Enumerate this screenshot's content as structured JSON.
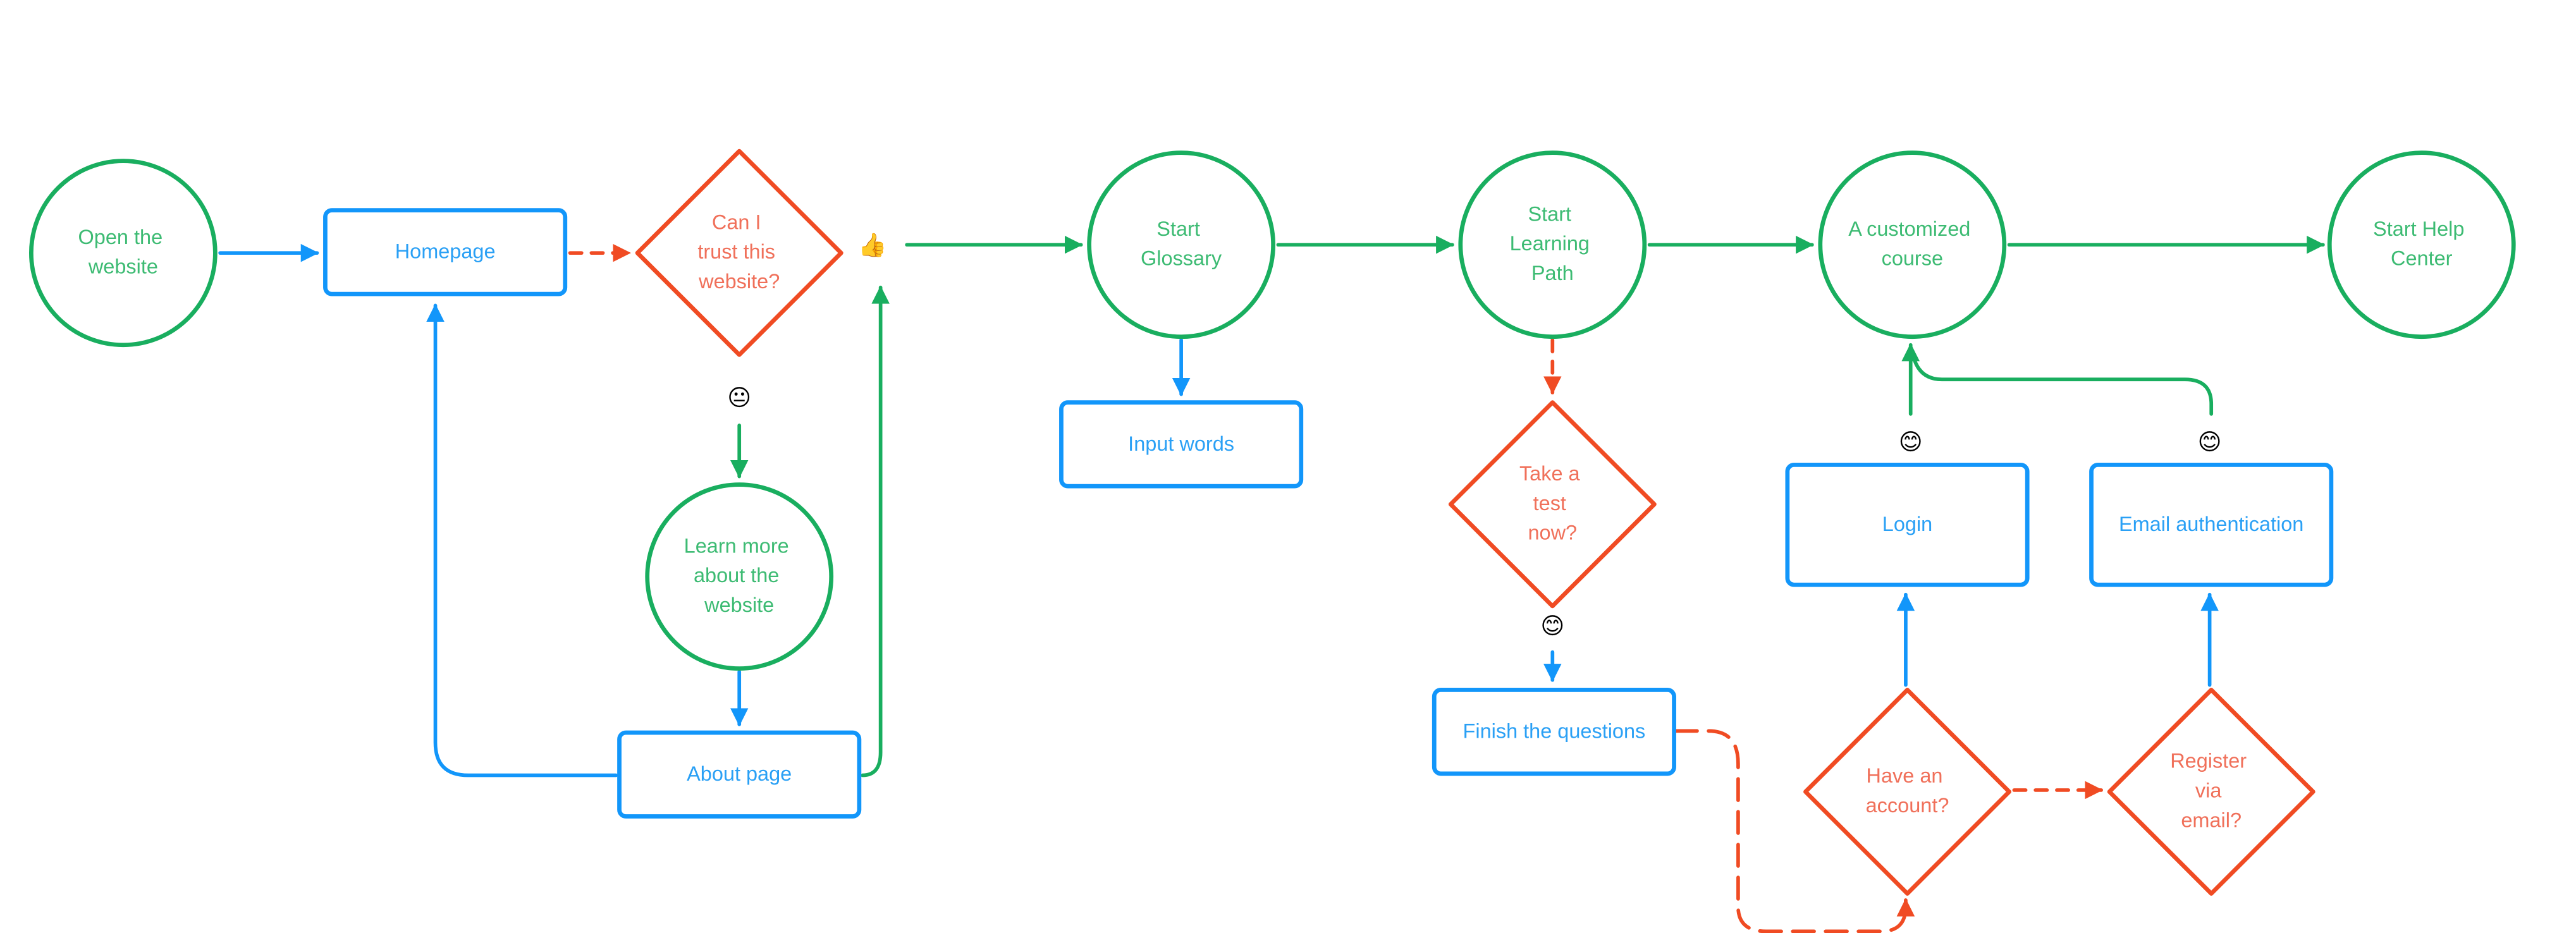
{
  "colors": {
    "process": "#1296FA",
    "process_text": "#2AA0F5",
    "terminal": "#19AE5F",
    "terminal_text": "#3DBB73",
    "decision": "#F04B23",
    "decision_text": "#F0705A"
  },
  "nodes": {
    "open_website": {
      "type": "circle",
      "lines": [
        "Open the",
        "website"
      ]
    },
    "homepage": {
      "type": "rect",
      "lines": [
        "Homepage"
      ]
    },
    "trust_decision": {
      "type": "diamond",
      "lines": [
        "Can I",
        "trust this",
        "website?"
      ]
    },
    "learn_more": {
      "type": "circle",
      "lines": [
        "Learn more",
        "about the",
        "website"
      ]
    },
    "about_page": {
      "type": "rect",
      "lines": [
        "About page"
      ]
    },
    "start_glossary": {
      "type": "circle",
      "lines": [
        "Start",
        "Glossary"
      ]
    },
    "input_words": {
      "type": "rect",
      "lines": [
        "Input words"
      ]
    },
    "start_learning_path": {
      "type": "circle",
      "lines": [
        "Start",
        "Learning",
        "Path"
      ]
    },
    "take_test": {
      "type": "diamond",
      "lines": [
        "Take a",
        "test",
        "now?"
      ]
    },
    "finish_questions": {
      "type": "rect",
      "lines": [
        "Finish the questions"
      ]
    },
    "customized_course": {
      "type": "circle",
      "lines": [
        "A customized",
        "course"
      ]
    },
    "start_help_center": {
      "type": "circle",
      "lines": [
        "Start Help",
        "Center"
      ]
    },
    "login": {
      "type": "rect",
      "lines": [
        "Login"
      ]
    },
    "email_auth": {
      "type": "rect",
      "lines": [
        "Email authentication"
      ]
    },
    "have_account": {
      "type": "diamond",
      "lines": [
        "Have an",
        "account?"
      ]
    },
    "register_email": {
      "type": "diamond",
      "lines": [
        "Register",
        "via",
        "email?"
      ]
    }
  },
  "emojis": {
    "thumbs_up": "👍",
    "neutral_face": "😐",
    "smile_test": "😊",
    "smile_login": "😊",
    "smile_email": "😊"
  },
  "edges": [
    {
      "from": "open_website",
      "to": "homepage",
      "style": "solid",
      "color": "process"
    },
    {
      "from": "homepage",
      "to": "trust_decision",
      "style": "dashed",
      "color": "decision"
    },
    {
      "from": "trust_decision",
      "to": "start_glossary",
      "style": "solid",
      "color": "terminal",
      "label": "thumbs_up"
    },
    {
      "from": "trust_decision",
      "to": "learn_more",
      "style": "solid",
      "color": "terminal",
      "label": "neutral_face"
    },
    {
      "from": "learn_more",
      "to": "about_page",
      "style": "solid",
      "color": "process"
    },
    {
      "from": "about_page",
      "to": "homepage",
      "style": "solid",
      "color": "process"
    },
    {
      "from": "about_page",
      "to": "trust_decision",
      "style": "solid",
      "color": "terminal"
    },
    {
      "from": "start_glossary",
      "to": "input_words",
      "style": "solid",
      "color": "process"
    },
    {
      "from": "start_glossary",
      "to": "start_learning_path",
      "style": "solid",
      "color": "terminal"
    },
    {
      "from": "start_learning_path",
      "to": "take_test",
      "style": "dashed",
      "color": "decision"
    },
    {
      "from": "take_test",
      "to": "finish_questions",
      "style": "dashed",
      "color": "process",
      "label": "smile_test"
    },
    {
      "from": "finish_questions",
      "to": "have_account",
      "style": "dashed",
      "color": "decision"
    },
    {
      "from": "start_learning_path",
      "to": "customized_course",
      "style": "solid",
      "color": "terminal"
    },
    {
      "from": "customized_course",
      "to": "start_help_center",
      "style": "solid",
      "color": "terminal"
    },
    {
      "from": "have_account",
      "to": "login",
      "style": "solid",
      "color": "process"
    },
    {
      "from": "have_account",
      "to": "register_email",
      "style": "dashed",
      "color": "decision"
    },
    {
      "from": "register_email",
      "to": "email_auth",
      "style": "solid",
      "color": "process"
    },
    {
      "from": "login",
      "to": "customized_course",
      "style": "solid",
      "color": "terminal",
      "label": "smile_login"
    },
    {
      "from": "email_auth",
      "to": "customized_course",
      "style": "solid",
      "color": "terminal",
      "label": "smile_email"
    }
  ]
}
